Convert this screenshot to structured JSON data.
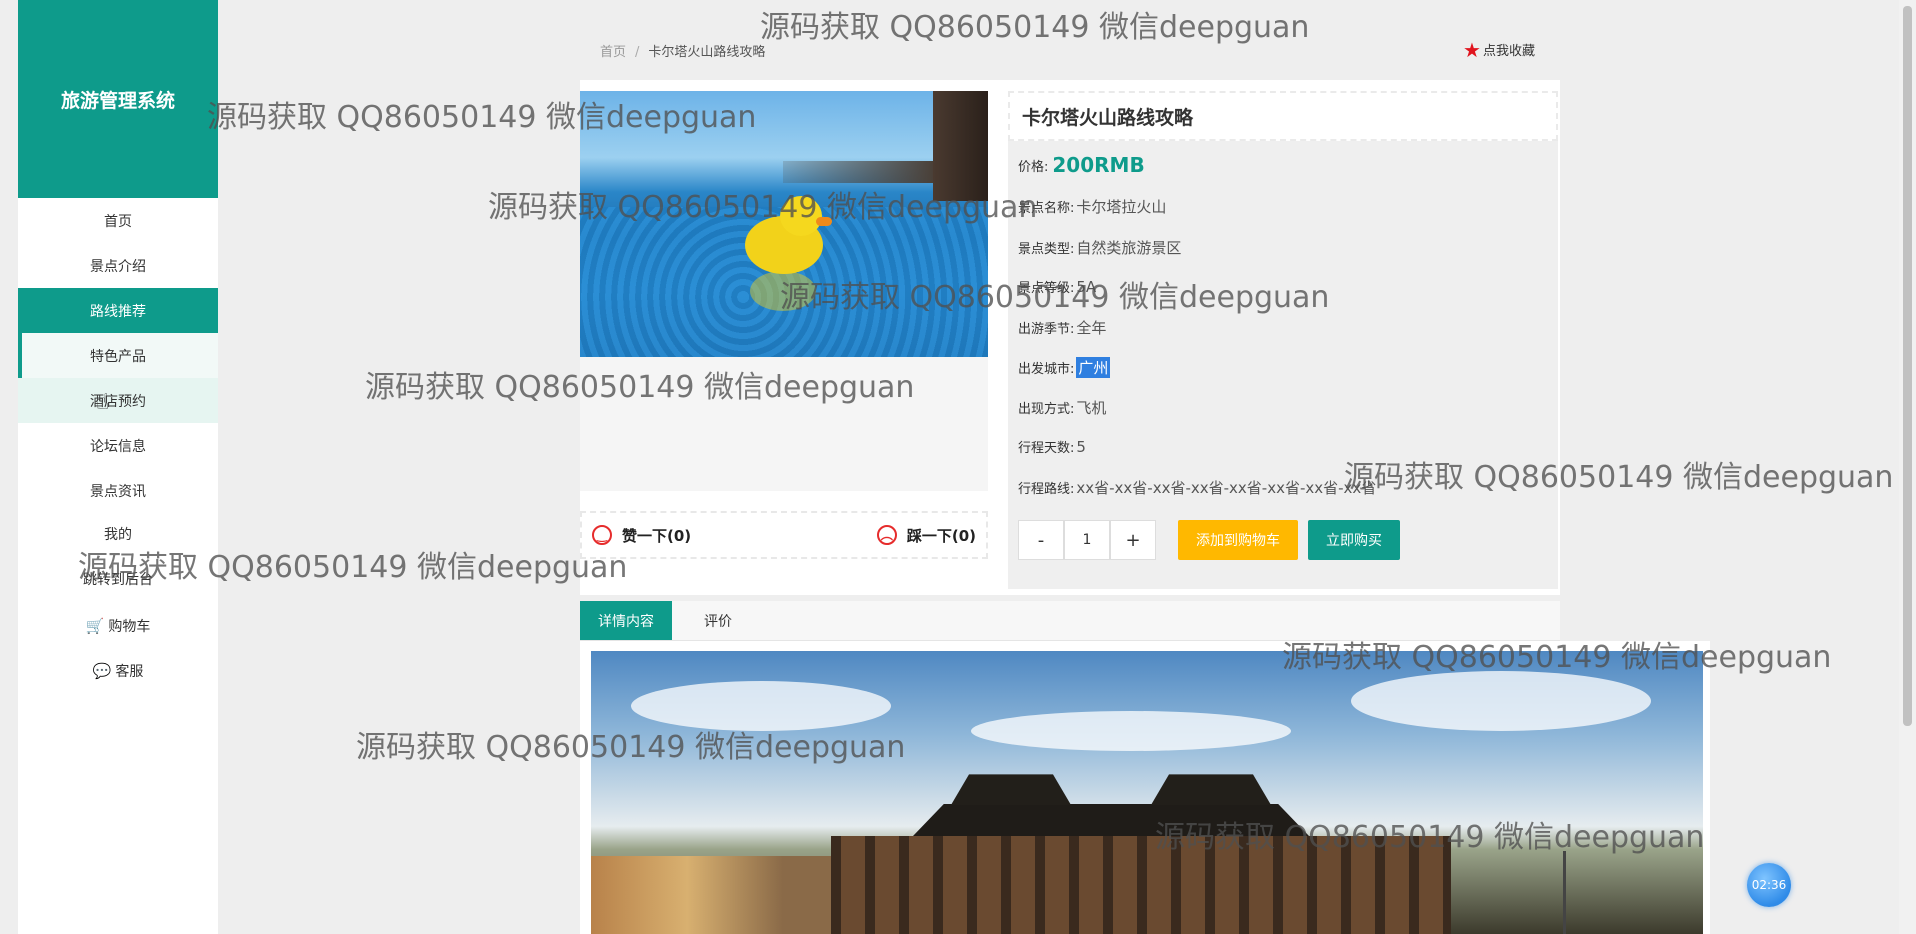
{
  "app": {
    "title": "旅游管理系统"
  },
  "sidebar": {
    "items": [
      {
        "label": "首页"
      },
      {
        "label": "景点介绍"
      },
      {
        "label": "路线推荐"
      },
      {
        "label": "特色产品"
      },
      {
        "label": "酒店预约"
      },
      {
        "label": "论坛信息"
      },
      {
        "label": "景点资讯"
      },
      {
        "label": "我的"
      },
      {
        "label": "跳转到后台"
      },
      {
        "label": "购物车"
      },
      {
        "label": "客服"
      }
    ]
  },
  "breadcrumb": {
    "home": "首页",
    "sep": "/",
    "current": "卡尔塔火山路线攻略"
  },
  "collect": {
    "label": "点我收藏"
  },
  "votes": {
    "like": "赞一下(0)",
    "dislike": "踩一下(0)"
  },
  "product": {
    "title": "卡尔塔火山路线攻略",
    "price_label": "价格:",
    "price": "200RMB",
    "fields": [
      {
        "label": "景点名称:",
        "value": "卡尔塔拉火山"
      },
      {
        "label": "景点类型:",
        "value": "自然类旅游景区"
      },
      {
        "label": "景点等级:",
        "value": "5A"
      },
      {
        "label": "出游季节:",
        "value": "全年"
      },
      {
        "label": "出发城市:",
        "value": "广州"
      },
      {
        "label": "出现方式:",
        "value": "飞机"
      },
      {
        "label": "行程天数:",
        "value": "5"
      },
      {
        "label": "行程路线:",
        "value": "xx省-xx省-xx省-xx省-xx省-xx省-xx省-xx省"
      }
    ],
    "quantity": "1",
    "minus": "-",
    "plus": "+",
    "add_to_cart": "添加到购物车",
    "buy_now": "立即购买"
  },
  "tabs": [
    {
      "label": "详情内容"
    },
    {
      "label": "评价"
    }
  ],
  "timer": "02:36",
  "watermark": "源码获取 QQ86050149 微信deepguan",
  "colors": {
    "accent": "#0e9b8b",
    "warning": "#ffb800",
    "star": "#e0141e"
  }
}
